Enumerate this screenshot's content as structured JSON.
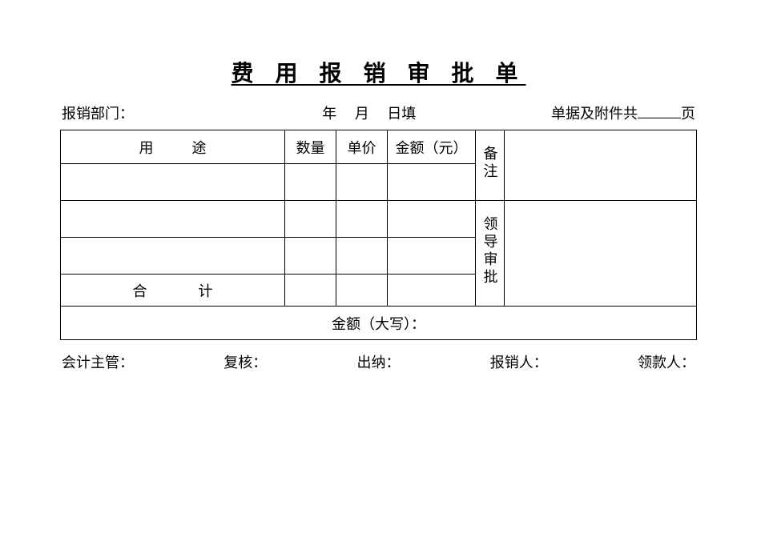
{
  "title": "费 用 报 销 审 批 单",
  "header": {
    "dept_label": "报销部门：",
    "date_year": "年",
    "date_month": "月",
    "date_day_fill": "日填",
    "attach_prefix": "单据及附件共",
    "attach_suffix": "页"
  },
  "table": {
    "col_use": "用途",
    "col_qty": "数量",
    "col_price": "单价",
    "col_amount": "金额（元）",
    "side_remark": "备注",
    "side_approval": "领导审批",
    "total_label": "合计",
    "rows": [
      {
        "use": "",
        "qty": "",
        "price": "",
        "amount": ""
      },
      {
        "use": "",
        "qty": "",
        "price": "",
        "amount": ""
      },
      {
        "use": "",
        "qty": "",
        "price": "",
        "amount": ""
      }
    ],
    "amount_upper_label": "金额（大写）："
  },
  "footer": {
    "acct_mgr": "会计主管：",
    "reviewer": "复核：",
    "cashier": "出纳：",
    "claimant": "报销人：",
    "payee": "领款人："
  }
}
